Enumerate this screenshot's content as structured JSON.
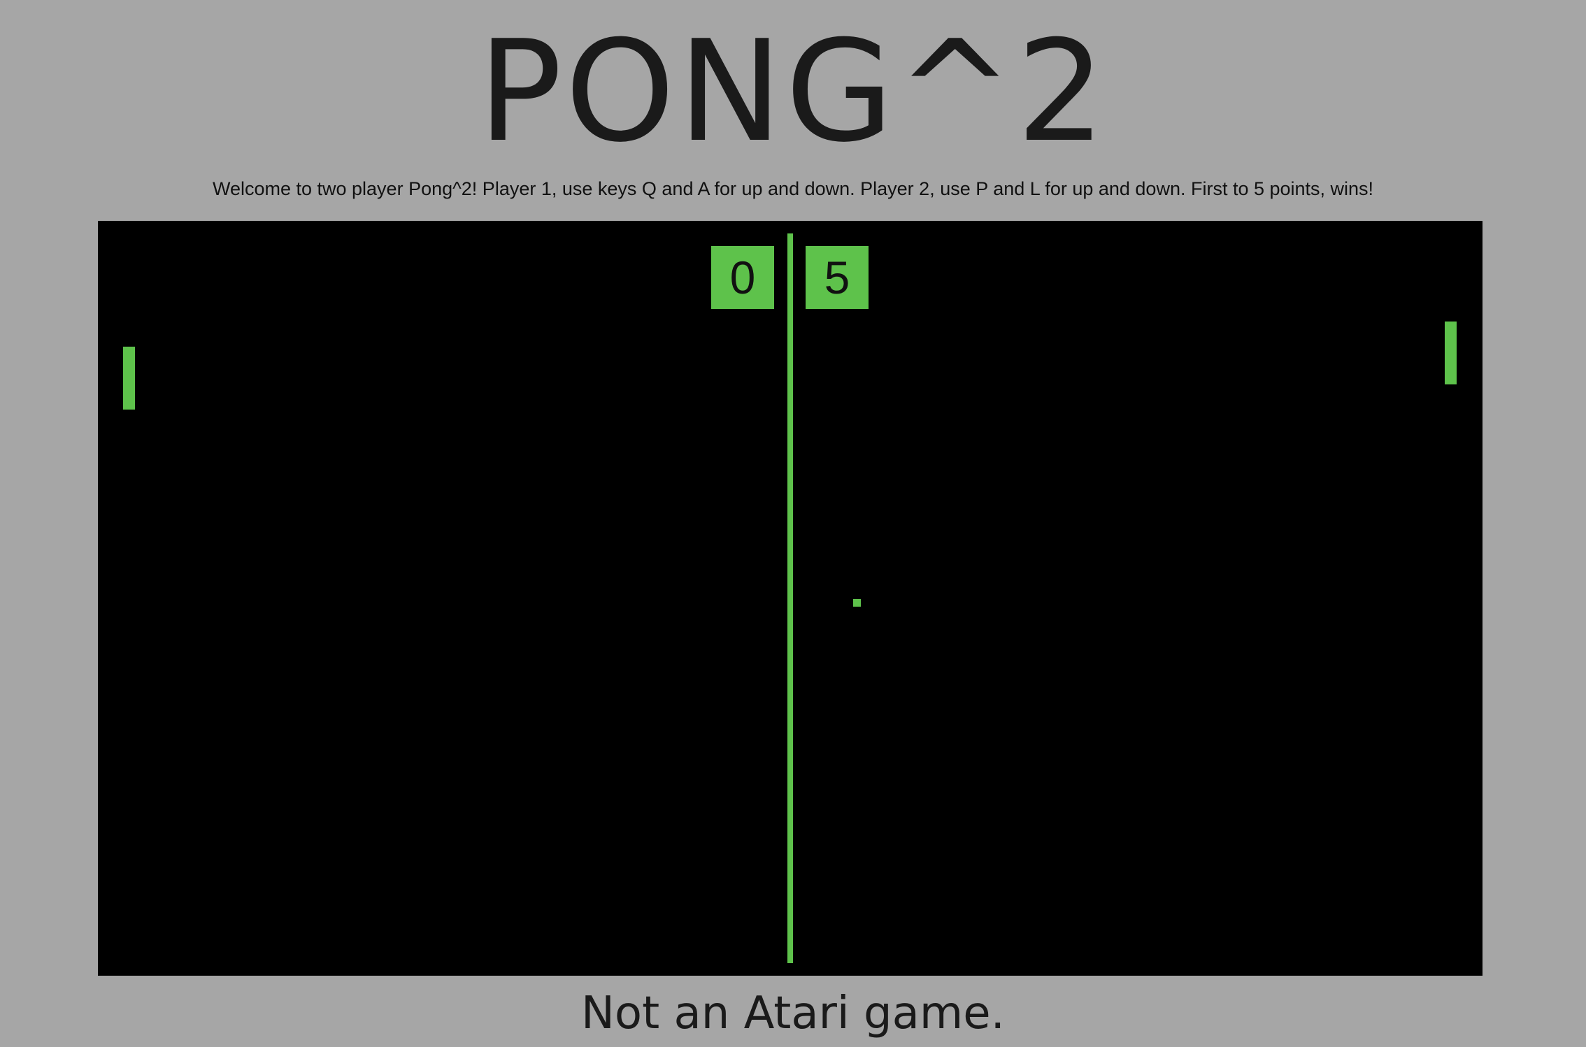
{
  "title": "PONG^2",
  "intro": "Welcome to two player Pong^2! Player 1, use keys Q and A for up and down. Player 2, use P and L for up and down. First to 5 points, wins!",
  "game": {
    "score_left": "0",
    "score_right": "5"
  },
  "tagline": "Not an Atari game.",
  "colors": {
    "page_background": "#a6a6a6",
    "court_background": "#000000",
    "accent_green": "#5ec24b",
    "text_dark": "#1a1a1a"
  }
}
